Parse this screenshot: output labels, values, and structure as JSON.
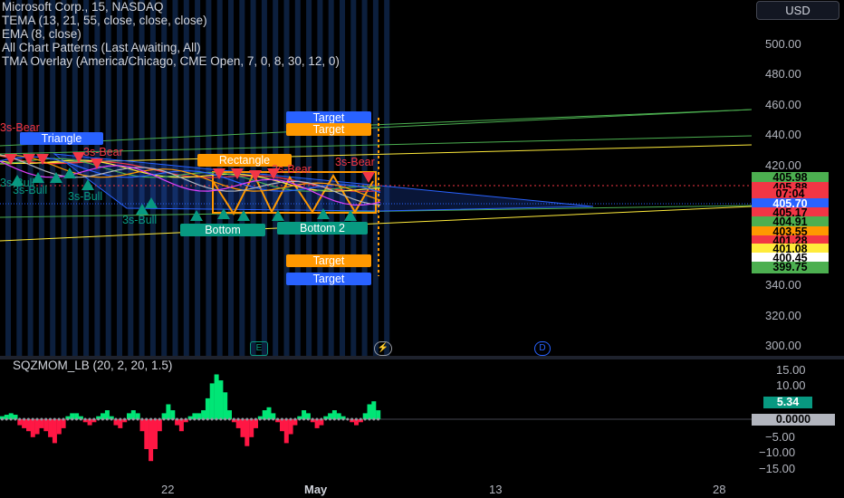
{
  "chart": {
    "symbol_line": "Microsoft Corp., 15, NASDAQ",
    "indicators": [
      "TEMA (13, 21, 55, close, close, close)",
      "EMA (8, close)",
      "All Chart Patterns (Last Awaiting, All)",
      "TMA Overlay (America/Chicago, CME Open, 7, 0, 8, 30, 12, 0)"
    ],
    "currency_button": "USD",
    "oscillator_legend": "SQZMOM_LB (20, 2, 20, 1.5)"
  },
  "price_axis": {
    "ticks": [
      "500.00",
      "480.00",
      "460.00",
      "440.00",
      "420.00",
      "340.00",
      "320.00",
      "300.00"
    ]
  },
  "price_tags": [
    {
      "text": "405.98",
      "bg": "#4caf50",
      "fg": "#000000"
    },
    {
      "text": "405.88",
      "bg": "#f23645",
      "fg": "#000000"
    },
    {
      "text": "07:04",
      "bg": "#f23645",
      "fg": "#000000"
    },
    {
      "text": "405.70",
      "bg": "#2962ff",
      "fg": "#ffffff"
    },
    {
      "text": "405.17",
      "bg": "#f23645",
      "fg": "#000000"
    },
    {
      "text": "404.91",
      "bg": "#4caf50",
      "fg": "#000000"
    },
    {
      "text": "403.55",
      "bg": "#ff9800",
      "fg": "#000000"
    },
    {
      "text": "401.28",
      "bg": "#f23645",
      "fg": "#000000"
    },
    {
      "text": "401.08",
      "bg": "#ffeb3b",
      "fg": "#000000"
    },
    {
      "text": "400.45",
      "bg": "#ffffff",
      "fg": "#000000"
    },
    {
      "text": "399.75",
      "bg": "#4caf50",
      "fg": "#000000"
    }
  ],
  "osc_axis": {
    "ticks": [
      "15.00",
      "10.00",
      "5.00",
      "0.00",
      "−5.00",
      "−10.00",
      "−15.00"
    ],
    "tag_value": {
      "text": "5.34",
      "bg": "#089981"
    },
    "tag_zero": {
      "text": "0.0000",
      "bg": "#b2b5be"
    }
  },
  "time_axis": {
    "labels": [
      "22",
      "May",
      "13",
      "28"
    ]
  },
  "pattern_labels": {
    "target_1": "Target",
    "target_2": "Target",
    "target_3": "Target",
    "target_4": "Target",
    "triangle": "Triangle",
    "rectangle": "Rectangle",
    "bottom": "Bottom",
    "bottom_2": "Bottom 2"
  },
  "pattern_texts": {
    "bear_1": "3s-Bear",
    "bear_2": "3s-Bear",
    "bear_3": "3s-Bear",
    "bear_4": "3s-Bear",
    "bull_1": "3s-Bull",
    "bull_2": "3s-Bull",
    "bull_3": "3s-Bull",
    "bull_4": "3s-Bull"
  },
  "markers": {
    "earnings": "E",
    "split": "⚡",
    "dividend": "D"
  },
  "colors": {
    "background": "#000000",
    "session_stripe": "#0c1f3d",
    "bull": "#089981",
    "bear": "#f23645",
    "target_orange": "#ff9800",
    "target_blue": "#2962ff"
  }
}
